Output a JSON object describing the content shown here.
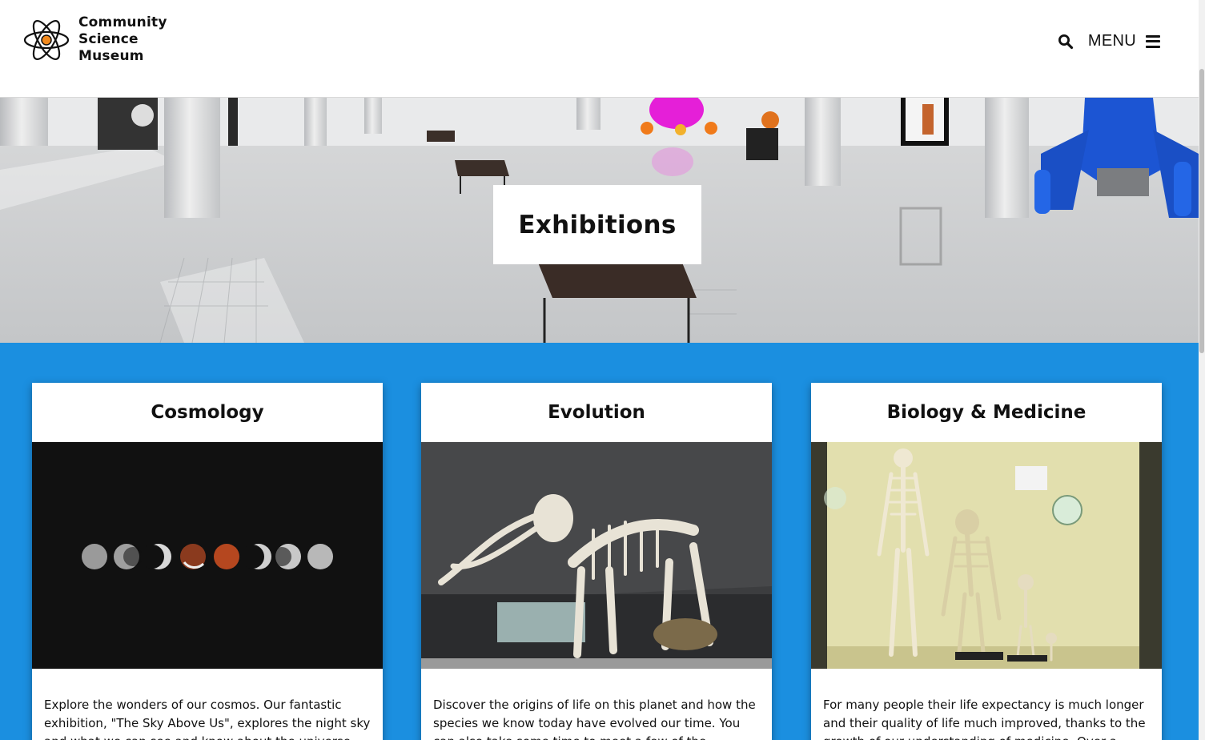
{
  "header": {
    "logo_line1": "Community",
    "logo_line2": "Science",
    "logo_line3": "Museum",
    "menu_label": "MENU"
  },
  "hero": {
    "title": "Exhibitions",
    "background_icon": "gallery-hall-photo"
  },
  "colors": {
    "section_background": "#1b8fe0",
    "card_background": "#ffffff",
    "logo_accent": "#f28a1e"
  },
  "cards": [
    {
      "title": "Cosmology",
      "image": "lunar-eclipse-phases-photo",
      "text": "Explore the wonders of our cosmos. Our fantastic exhibition, \"The Sky Above Us\", explores the night sky and what we can see and know about the universe."
    },
    {
      "title": "Evolution",
      "image": "mammoth-skeleton-photo",
      "text": "Discover the origins of life on this planet and how the species we know today have evolved our time. You can also take some time to meet a few of the creatures who"
    },
    {
      "title": "Biology & Medicine",
      "image": "skeletons-display-case-photo",
      "text": "For many people their life expectancy is much longer and their quality of life much improved, thanks to the growth of our understanding of medicine. Over a series of"
    }
  ]
}
